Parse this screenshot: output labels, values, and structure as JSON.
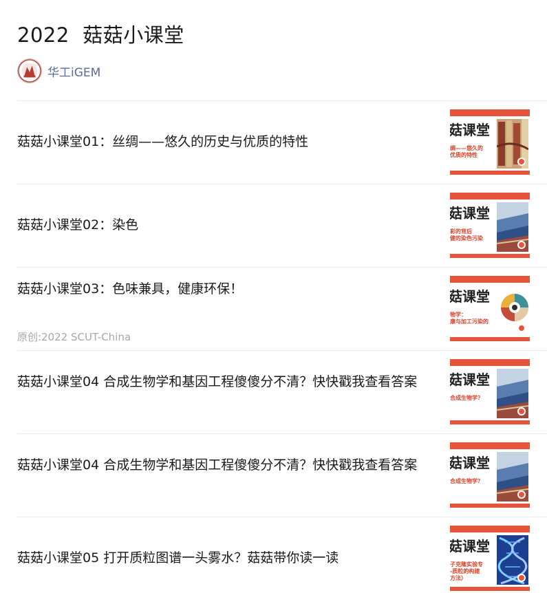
{
  "article": {
    "title": "2022  菇菇小课堂",
    "account_name": "华工iGEM"
  },
  "items": [
    {
      "title": "菇菇小课堂01：丝绸——悠久的历史与优质的特性",
      "meta": "",
      "thumb": {
        "heading": "菇课堂",
        "caption": "绸——悠久的\n优质的特性",
        "pic": "silk-picture"
      }
    },
    {
      "title": "菇菇小课堂02：染色",
      "meta": "",
      "thumb": {
        "heading": "菇课堂",
        "caption": "彩的背后\n健的染色污染",
        "pic": "dye-factory-picture"
      }
    },
    {
      "title": "菇菇小课堂03：色味兼具，健康环保！",
      "meta": "原创:2022 SCUT-China",
      "thumb": {
        "heading": "菇课堂",
        "caption": "物学：\n康与加工污染的",
        "pic": "food-color-wheel-picture"
      }
    },
    {
      "title": "菇菇小课堂04 合成生物学和基因工程傻傻分不清？快快戳我查看答案",
      "meta": "",
      "thumb": {
        "heading": "菇课堂",
        "caption": "合成生物学？",
        "pic": "dye-factory-picture"
      }
    },
    {
      "title": "菇菇小课堂04 合成生物学和基因工程傻傻分不清？快快戳我查看答案",
      "meta": "",
      "thumb": {
        "heading": "菇课堂",
        "caption": "合成生物学？",
        "pic": "dye-factory-picture"
      }
    },
    {
      "title": "菇菇小课堂05 打开质粒图谱一头雾水？菇菇带你读一读",
      "meta": "",
      "thumb": {
        "heading": "菇课堂",
        "caption": "子克隆实验专\n-质粒的构建\n方法）",
        "pic": "dna-helix-picture"
      }
    }
  ]
}
